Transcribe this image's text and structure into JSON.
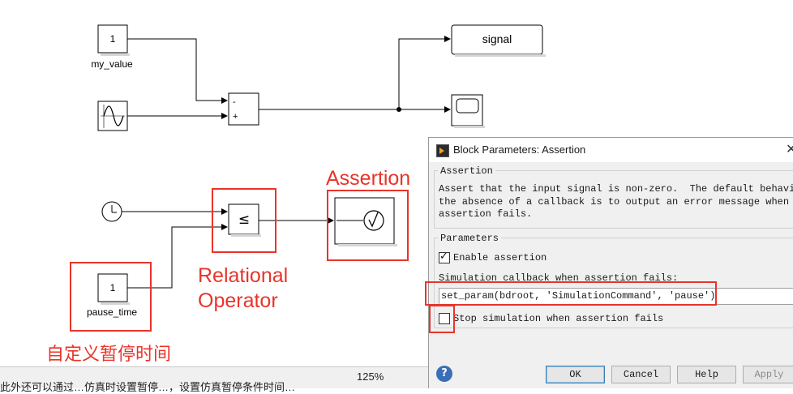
{
  "diagram": {
    "blocks": {
      "my_value_const": {
        "value": "1",
        "label": "my_value"
      },
      "sine": {
        "icon": "sine-wave-icon"
      },
      "sum": {
        "plus": "+",
        "minus": "-"
      },
      "signal_out": {
        "label": "signal"
      },
      "scope": {
        "icon": "scope-icon"
      },
      "clock": {
        "icon": "clock-icon"
      },
      "relop": {
        "symbol": "≤"
      },
      "assertion": {
        "icon": "check-circle-icon"
      },
      "pause_time_const": {
        "value": "1",
        "label": "pause_time"
      }
    }
  },
  "annotations": {
    "assertion": "Assertion",
    "relational": "Relational\nOperator",
    "pause_time_cn": "自定义暂停时间",
    "color": "#e8342a"
  },
  "statusbar": {
    "zoom": "125%",
    "partial_text": "此外还可以通过…仿真时设置暂停…，设置仿真暂停条件时间…"
  },
  "dialog": {
    "title": "Block Parameters: Assertion",
    "close_glyph": "✕",
    "assertion_group": {
      "title": "Assertion",
      "description": "Assert that the input signal is non-zero.  The default behavior in\nthe absence of a callback is to output an error message when the\nassertion fails."
    },
    "parameters_group": {
      "title": "Parameters",
      "enable_label": "Enable assertion",
      "enable_checked": true,
      "callback_label": "Simulation callback when assertion fails:",
      "callback_value": "set_param(bdroot, 'SimulationCommand', 'pause')",
      "stop_label": "Stop simulation when assertion fails",
      "stop_checked": false
    },
    "buttons": {
      "ok": "OK",
      "cancel": "Cancel",
      "help": "Help",
      "apply": "Apply"
    },
    "help_glyph": "?"
  }
}
